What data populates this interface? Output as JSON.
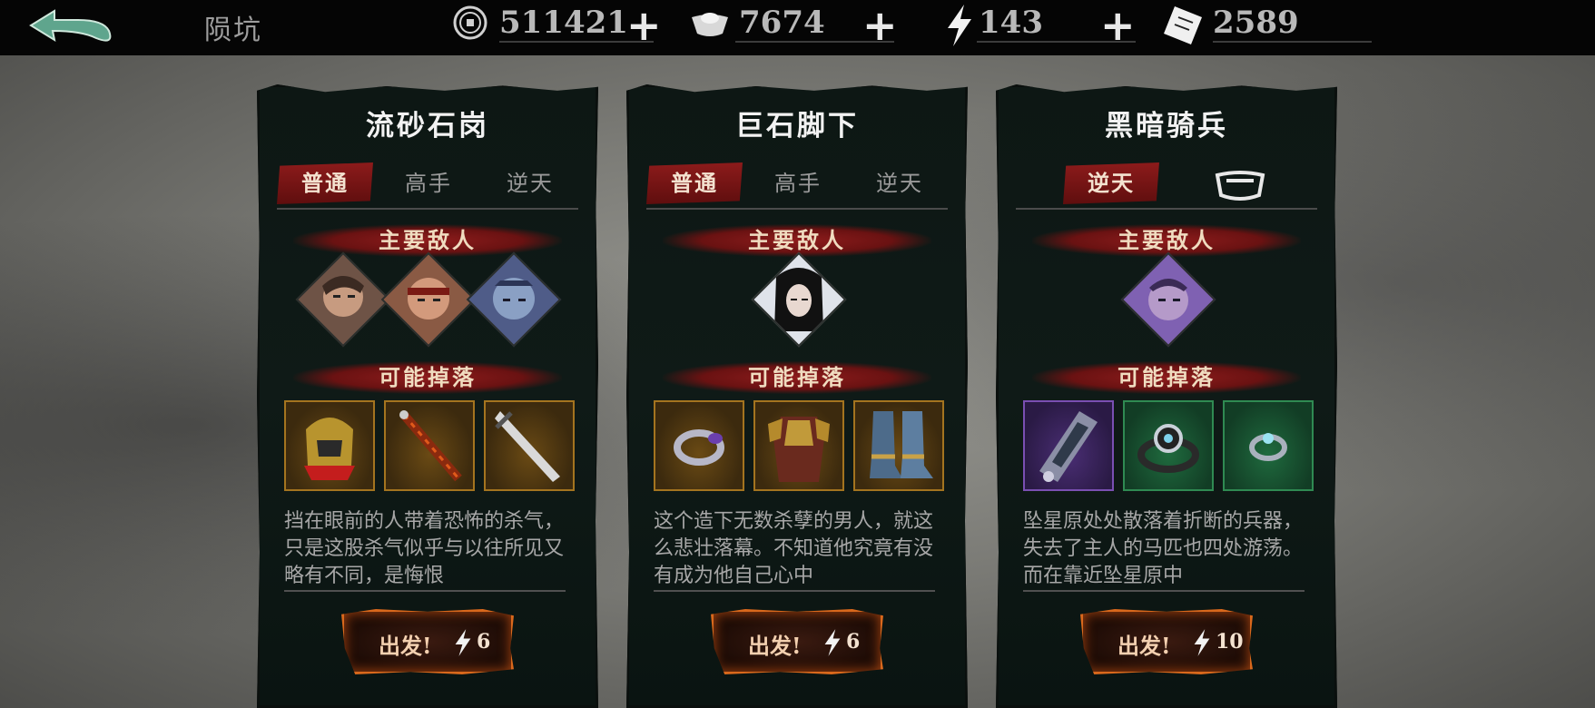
{
  "header": {
    "location": "陨坑",
    "resources": [
      {
        "icon": "coin-icon",
        "value": "511421"
      },
      {
        "icon": "silver-ingot-icon",
        "value": "7674"
      },
      {
        "icon": "lightning-icon",
        "value": "143"
      },
      {
        "icon": "ticket-icon",
        "value": "2589"
      }
    ],
    "plus": "+"
  },
  "labels": {
    "enemies": "主要敌人",
    "drops": "可能掉落",
    "go": "出发!"
  },
  "panels": [
    {
      "title": "流砂石岗",
      "tabs": [
        "普通",
        "高手",
        "逆天"
      ],
      "active_tab": "普通",
      "enemies": [
        "enemy-portrait-1",
        "enemy-portrait-2",
        "enemy-portrait-3"
      ],
      "drops": [
        {
          "name": "helmet-item-icon",
          "rarity": "gold"
        },
        {
          "name": "whip-item-icon",
          "rarity": "gold"
        },
        {
          "name": "greatsword-item-icon",
          "rarity": "gold"
        }
      ],
      "description": "挡在眼前的人带着恐怖的杀气，只是这股杀气似乎与以往所见又略有不同，是悔恨",
      "cost": "6"
    },
    {
      "title": "巨石脚下",
      "tabs": [
        "普通",
        "高手",
        "逆天"
      ],
      "active_tab": "普通",
      "enemies": [
        "boss-portrait"
      ],
      "drops": [
        {
          "name": "ring-item-icon",
          "rarity": "gold"
        },
        {
          "name": "armor-item-icon",
          "rarity": "gold"
        },
        {
          "name": "boots-item-icon",
          "rarity": "gold"
        }
      ],
      "description": "这个造下无数杀孽的男人，就这么悲壮落幕。不知道他究竟有没有成为他自己心中",
      "cost": "6"
    },
    {
      "title": "黑暗骑兵",
      "tabs": [
        "逆天"
      ],
      "active_tab": "逆天",
      "enemies": [
        "dark-knight-portrait"
      ],
      "drops": [
        {
          "name": "bracer-item-icon",
          "rarity": "purple"
        },
        {
          "name": "amulet-item-icon",
          "rarity": "green"
        },
        {
          "name": "ring-item-icon",
          "rarity": "green"
        }
      ],
      "description": "坠星原处处散落着折断的兵器，失去了主人的马匹也四处游荡。而在靠近坠星原中",
      "cost": "10"
    }
  ]
}
